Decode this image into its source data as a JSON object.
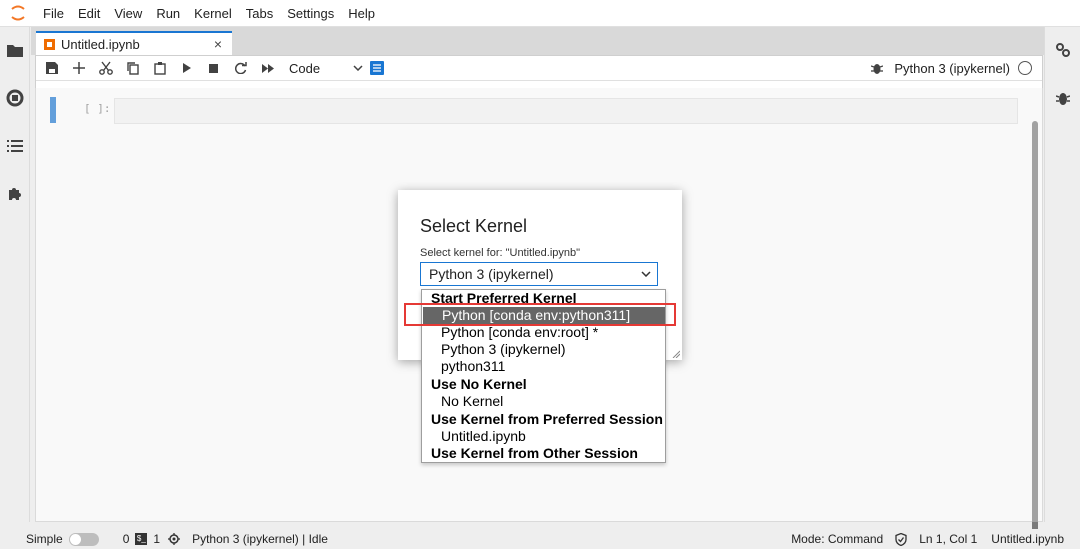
{
  "menu": [
    "File",
    "Edit",
    "View",
    "Run",
    "Kernel",
    "Tabs",
    "Settings",
    "Help"
  ],
  "tab": {
    "label": "Untitled.ipynb",
    "close": "×"
  },
  "toolbar": {
    "cell_type": "Code",
    "kernel_name": "Python 3 (ipykernel)"
  },
  "cell": {
    "prompt": "[ ]:"
  },
  "dialog": {
    "title": "Select Kernel",
    "label": "Select kernel for: \"Untitled.ipynb\"",
    "selected_value": "Python 3 (ipykernel)",
    "options": [
      {
        "label": "Start Preferred Kernel",
        "type": "group"
      },
      {
        "label": "Python [conda env:python311]",
        "type": "item",
        "selected": true
      },
      {
        "label": "Python [conda env:root] *",
        "type": "item"
      },
      {
        "label": "Python 3 (ipykernel)",
        "type": "item"
      },
      {
        "label": "python311",
        "type": "item"
      },
      {
        "label": "Use No Kernel",
        "type": "group"
      },
      {
        "label": "No Kernel",
        "type": "item"
      },
      {
        "label": "Use Kernel from Preferred Session",
        "type": "group"
      },
      {
        "label": "Untitled.ipynb",
        "type": "item"
      },
      {
        "label": "Use Kernel from Other Session",
        "type": "group"
      }
    ]
  },
  "status": {
    "mode_label": "Simple",
    "terminals": "0",
    "kernels": "1",
    "kernel_status": "Python 3 (ipykernel) | Idle",
    "mode": "Mode: Command",
    "position": "Ln 1, Col 1",
    "filename": "Untitled.ipynb"
  },
  "colors": {
    "accent": "#1976d2",
    "highlight": "#e53935",
    "selected_bg": "#666666"
  }
}
